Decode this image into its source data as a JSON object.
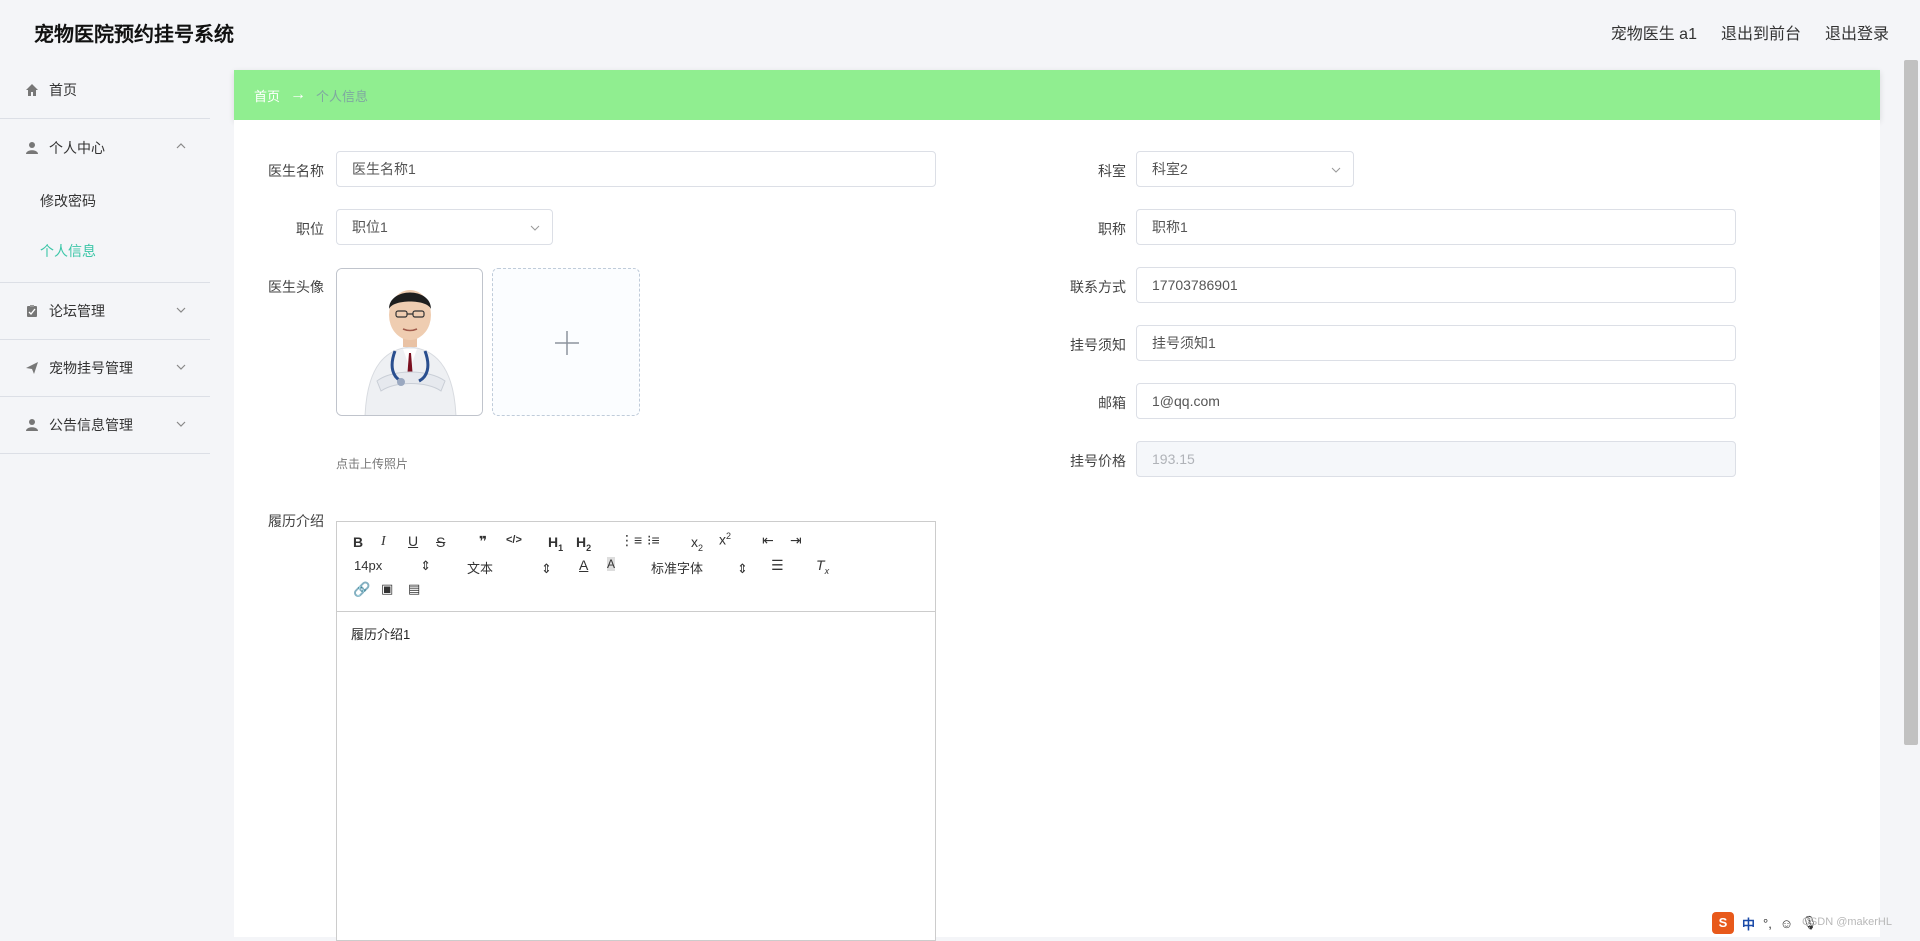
{
  "header": {
    "title": "宠物医院预约挂号系统",
    "user": "宠物医生 a1",
    "to_front": "退出到前台",
    "logout": "退出登录"
  },
  "sidebar": {
    "home": "首页",
    "personal_center": "个人中心",
    "change_password": "修改密码",
    "profile": "个人信息",
    "forum": "论坛管理",
    "registration": "宠物挂号管理",
    "notice": "公告信息管理"
  },
  "breadcrumb": {
    "home": "首页",
    "arrow": "→",
    "current": "个人信息"
  },
  "form": {
    "doctor_name_label": "医生名称",
    "doctor_name": "医生名称1",
    "department_label": "科室",
    "department": "科室2",
    "position_label": "职位",
    "position": "职位1",
    "title_label": "职称",
    "title": "职称1",
    "avatar_label": "医生头像",
    "contact_label": "联系方式",
    "contact": "17703786901",
    "notice_label": "挂号须知",
    "notice": "挂号须知1",
    "email_label": "邮箱",
    "email": "1@qq.com",
    "price_label": "挂号价格",
    "price": "193.15",
    "upload_hint": "点击上传照片",
    "resume_label": "履历介绍",
    "upload_plus": "+"
  },
  "editor": {
    "font_size": "14px",
    "block_type": "文本",
    "font_family": "标准字体",
    "content": "履历介绍1",
    "buttons": [
      "B",
      "I",
      "U",
      "S",
      "99",
      "</>",
      "H1",
      "H2",
      "x2",
      "x2"
    ]
  },
  "tray": {
    "ime": "S",
    "lang": "中",
    "punct": "°,",
    "watermark": "CSDN @makerHL"
  }
}
